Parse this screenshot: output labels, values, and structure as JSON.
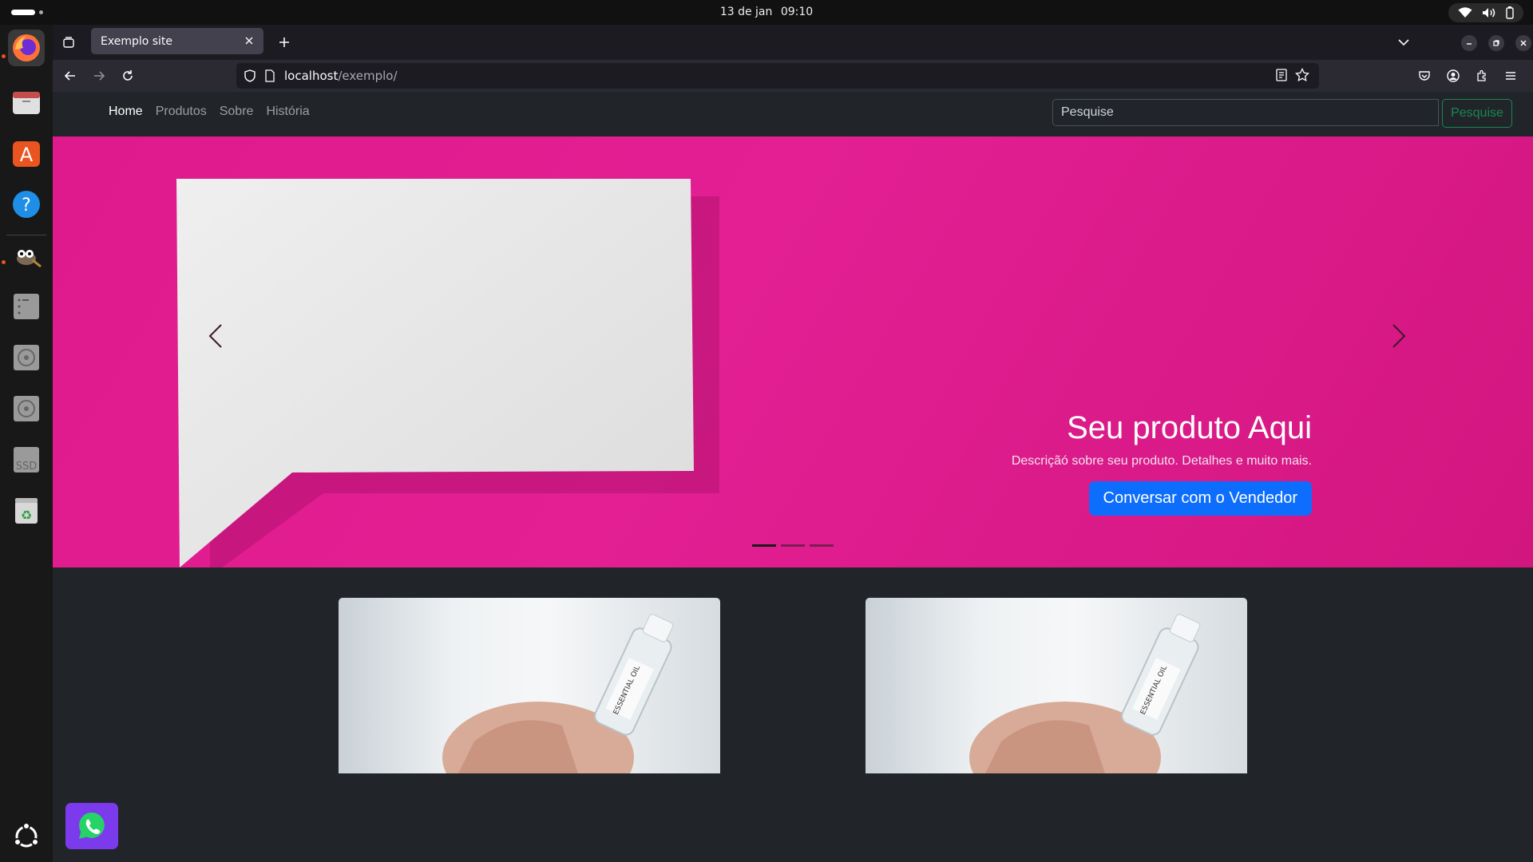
{
  "system": {
    "date": "13 de jan",
    "time": "09:10"
  },
  "dock": {
    "items": [
      "firefox-icon",
      "files-icon",
      "app-center-icon",
      "help-icon",
      "gimp-icon",
      "disk-icon",
      "cd-drive-icon",
      "cd-drive-icon",
      "ssd-drive-icon",
      "trash-icon"
    ],
    "ssd_label": "SSD"
  },
  "browser": {
    "tab_title": "Exemplo site",
    "url_host": "localhost",
    "url_path": "/exemplo/"
  },
  "site": {
    "nav": {
      "links": [
        "Home",
        "Produtos",
        "Sobre",
        "História"
      ]
    },
    "search": {
      "placeholder": "Pesquise",
      "button": "Pesquise"
    },
    "carousel": {
      "title": "Seu produto Aqui",
      "description": "Descriçãó sobre seu produto. Detalhes e muito mais.",
      "cta": "Conversar com o Vendedor",
      "slides_count": 3,
      "active_slide": 1
    },
    "products": {
      "label_text": "ESSENTIAL OIL"
    }
  },
  "colors": {
    "hero_pink": "#e01c8f",
    "primary_button": "#0d6efd",
    "search_outline": "#198754",
    "whatsapp_bg": "#7c3aed",
    "page_bg": "#212529"
  }
}
